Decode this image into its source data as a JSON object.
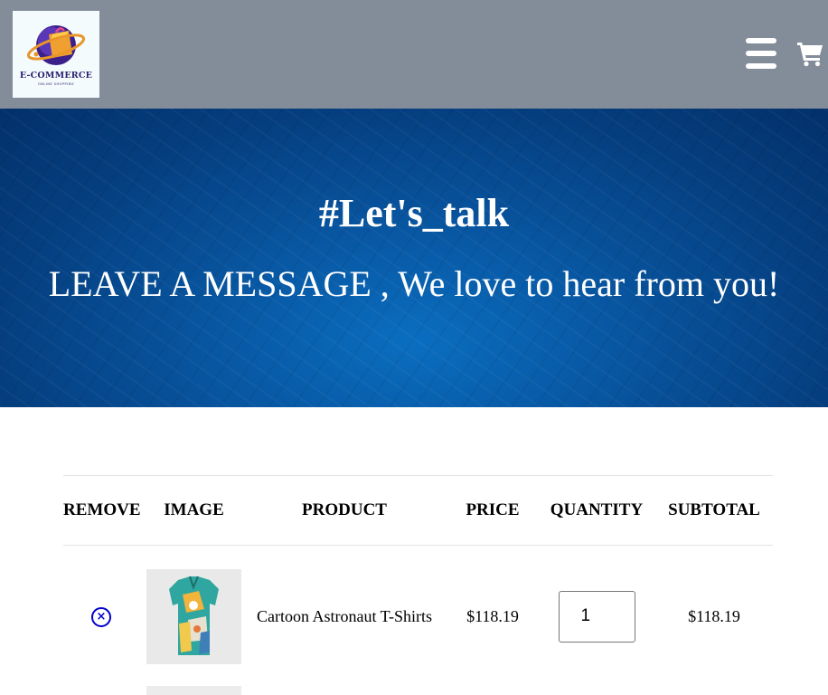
{
  "header": {
    "logo": {
      "brand": "E-COMMERCE",
      "tagline": "ONLINE SHOPPING"
    },
    "menu_icon": "hamburger-menu-icon",
    "cart_icon": "shopping-cart-icon",
    "background": "#838c99"
  },
  "hero": {
    "title": "#Let's_talk",
    "subtitle": "LEAVE A MESSAGE , We love to hear from you!"
  },
  "cart": {
    "columns": [
      "REMOVE",
      "IMAGE",
      "PRODUCT",
      "PRICE",
      "QUANTITY",
      "SUBTOTAL"
    ],
    "items": [
      {
        "remove_icon": "remove-circle-icon",
        "image": "product-shirt-image",
        "product": "Cartoon Astronaut T-Shirts",
        "price": "$118.19",
        "quantity": "1",
        "subtotal": "$118.19"
      }
    ]
  }
}
